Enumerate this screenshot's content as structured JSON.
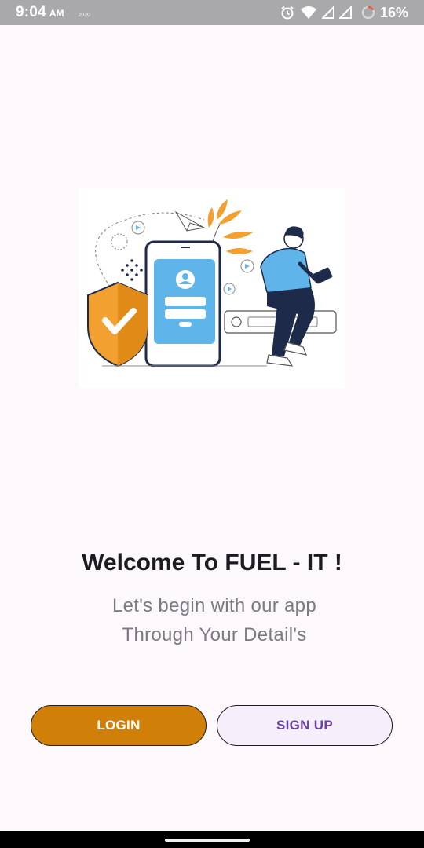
{
  "status_bar": {
    "time": "9:04",
    "ampm": "AM",
    "carrier": "2020",
    "battery_percent": "16%",
    "icons": [
      "alarm-icon",
      "wifi-icon",
      "signal-icon",
      "signal-icon",
      "battery-icon"
    ]
  },
  "illustration": {
    "icon": "login-security-illustration",
    "colors": {
      "orange": "#f2a030",
      "blue": "#5fb4ea",
      "navy": "#1d2a4a"
    }
  },
  "welcome": {
    "title": "Welcome To FUEL - IT !",
    "subtitle_line1": "Let's begin with our app",
    "subtitle_line2": "Through Your Detail's"
  },
  "buttons": {
    "login_label": "LOGIN",
    "signup_label": "SIGN UP"
  },
  "colors": {
    "login_bg": "#d08008",
    "signup_bg": "#f4effa",
    "signup_text": "#6a3fa6",
    "background": "#fdf8fc"
  }
}
